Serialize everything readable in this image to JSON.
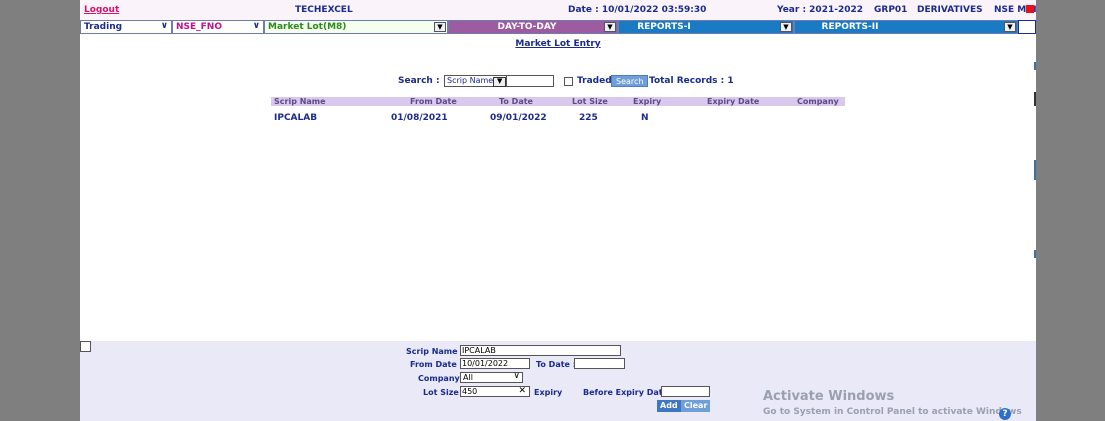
{
  "header": {
    "logout": "Logout",
    "app_name": "TECHEXCEL",
    "date": "Date : 10/01/2022 03:59:30",
    "year": "Year :  2021-2022",
    "group": "GRP01",
    "segment": "DERIVATIVES",
    "exchange": "NSE MAIN"
  },
  "menubar": {
    "trading": "Trading",
    "exchange": "NSE_FNO",
    "market_lot": "Market Lot(M8)",
    "day_to_day": "DAY-TO-DAY",
    "reports_1": "REPORTS-I",
    "reports_2": "REPORTS-II"
  },
  "page_title": "Market Lot Entry",
  "search": {
    "label": "Search :",
    "field_selected": "Scrip Name",
    "query": "",
    "traded_label": "Traded",
    "button": "Search",
    "total_records": "Total Records : 1"
  },
  "table": {
    "headers": [
      "Scrip Name",
      "From Date",
      "To Date",
      "Lot Size",
      "Expiry",
      "Expiry Date",
      "Company"
    ],
    "rows": [
      [
        "IPCALAB",
        "01/08/2021",
        "09/01/2022",
        "225",
        "N",
        "",
        ""
      ]
    ]
  },
  "form": {
    "scrip_name_label": "Scrip Name :",
    "scrip_name_value": "IPCALAB",
    "from_date_label": "From Date :",
    "from_date_value": "10/01/2022",
    "to_date_label": "To Date :",
    "to_date_value": "",
    "company_label": "Company:",
    "company_value": "All",
    "lot_size_label": "Lot Size :",
    "lot_size_value": "450",
    "expiry_label": "Expiry",
    "before_expiry_label": "Before Expiry Date",
    "before_expiry_value": "",
    "add_button": "Add",
    "clear_button": "Clear"
  },
  "watermark": {
    "title": "Activate Windows",
    "subtitle": "Go to System in Control Panel to activate Windows"
  },
  "colors": {
    "accent_navy": "#1a2b8c",
    "reports_blue": "#1a7bc4",
    "day_purple": "#9d5ba0",
    "table_header": "#d9c9ee",
    "form_bg": "#e9e9f8"
  }
}
